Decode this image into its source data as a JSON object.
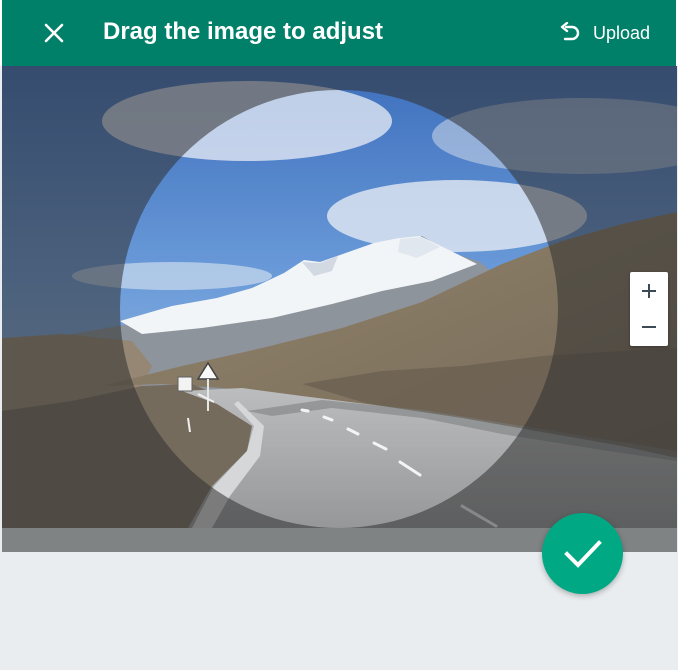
{
  "header": {
    "title": "Drag the image to adjust",
    "upload_label": "Upload",
    "close_icon": "close-icon",
    "upload_icon": "undo-arrow-icon"
  },
  "zoom": {
    "in_icon": "plus-icon",
    "out_icon": "minus-icon"
  },
  "confirm": {
    "icon": "checkmark-icon"
  },
  "colors": {
    "header_bg": "#008069",
    "confirm_bg": "#00a884",
    "panel_bg": "#e9edef"
  }
}
